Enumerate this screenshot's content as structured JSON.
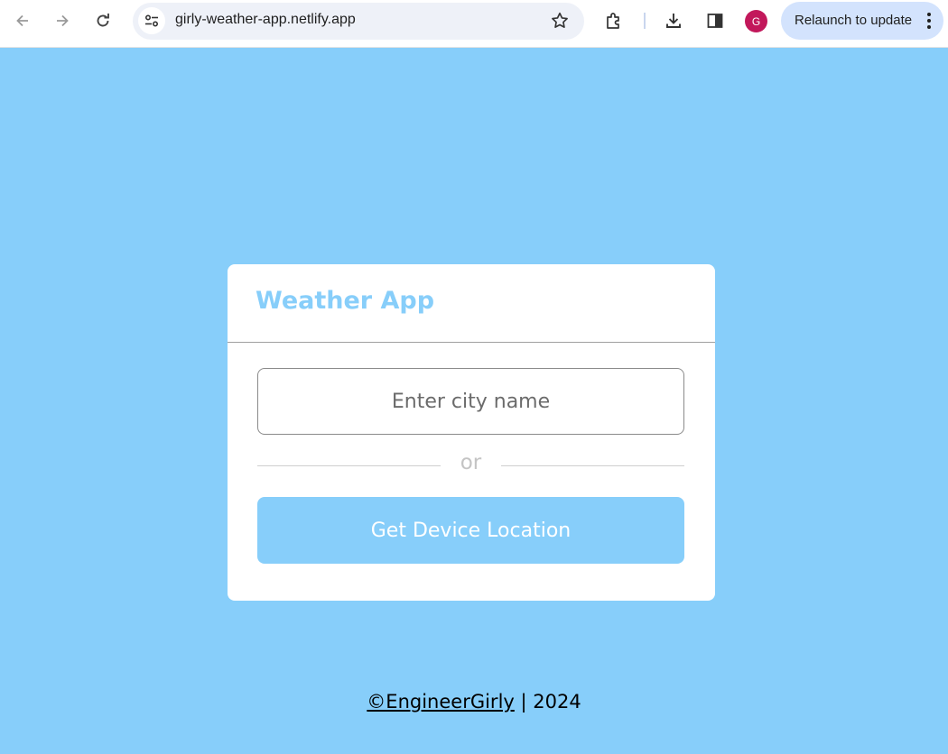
{
  "browser": {
    "url": "girly-weather-app.netlify.app",
    "profile_initial": "G",
    "relaunch_label": "Relaunch to update",
    "icons": [
      "back-arrow-icon",
      "forward-arrow-icon",
      "reload-icon",
      "site-info-icon",
      "bookmark-star-icon",
      "extensions-icon",
      "download-icon",
      "side-panel-icon",
      "more-vert-icon"
    ]
  },
  "app": {
    "title": "Weather App",
    "city_input": {
      "placeholder": "Enter city name",
      "value": ""
    },
    "separator": "or",
    "location_button": "Get Device Location"
  },
  "footer": {
    "author": "©EngineerGirly",
    "year_text": " | 2024"
  },
  "colors": {
    "background": "#87cefa",
    "accent": "#87cefa",
    "card": "#ffffff",
    "avatar": "#c2185b",
    "relaunch_chip": "#d3e3fd"
  }
}
